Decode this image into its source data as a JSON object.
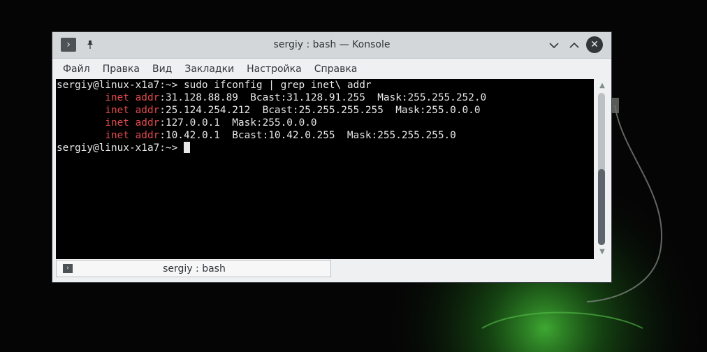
{
  "window": {
    "title": "sergiy : bash — Konsole",
    "app_icon_glyph": "›",
    "app_icon_name": "terminal-icon",
    "pin_icon_name": "pin-icon",
    "controls": {
      "minimize_glyph": "⌄",
      "maximize_glyph": "⌃",
      "close_glyph": "✕"
    }
  },
  "menubar": {
    "items": [
      "Файл",
      "Правка",
      "Вид",
      "Закладки",
      "Настройка",
      "Справка"
    ]
  },
  "terminal": {
    "prompt": "sergiy@linux-x1a7:~>",
    "command": " sudo ifconfig | grep inet\\ addr",
    "output": [
      {
        "indent": "        ",
        "kw1": "inet",
        "kw2": "addr",
        "rest": ":31.128.88.89  Bcast:31.128.91.255  Mask:255.255.252.0"
      },
      {
        "indent": "        ",
        "kw1": "inet",
        "kw2": "addr",
        "rest": ":25.124.254.212  Bcast:25.255.255.255  Mask:255.0.0.0"
      },
      {
        "indent": "        ",
        "kw1": "inet",
        "kw2": "addr",
        "rest": ":127.0.0.1  Mask:255.0.0.0"
      },
      {
        "indent": "        ",
        "kw1": "inet",
        "kw2": "addr",
        "rest": ":10.42.0.1  Bcast:10.42.0.255  Mask:255.255.255.0"
      }
    ],
    "final_prompt": "sergiy@linux-x1a7:~> ",
    "text_color": "#e8e8e8",
    "highlight_color": "#e2494d",
    "background": "#000000"
  },
  "scrollbar": {
    "position_fraction": 0.55,
    "thumb_fraction": 0.5,
    "up_glyph": "▲",
    "down_glyph": "▼"
  },
  "tabs": [
    {
      "label": "sergiy : bash",
      "icon_glyph": "›"
    }
  ]
}
